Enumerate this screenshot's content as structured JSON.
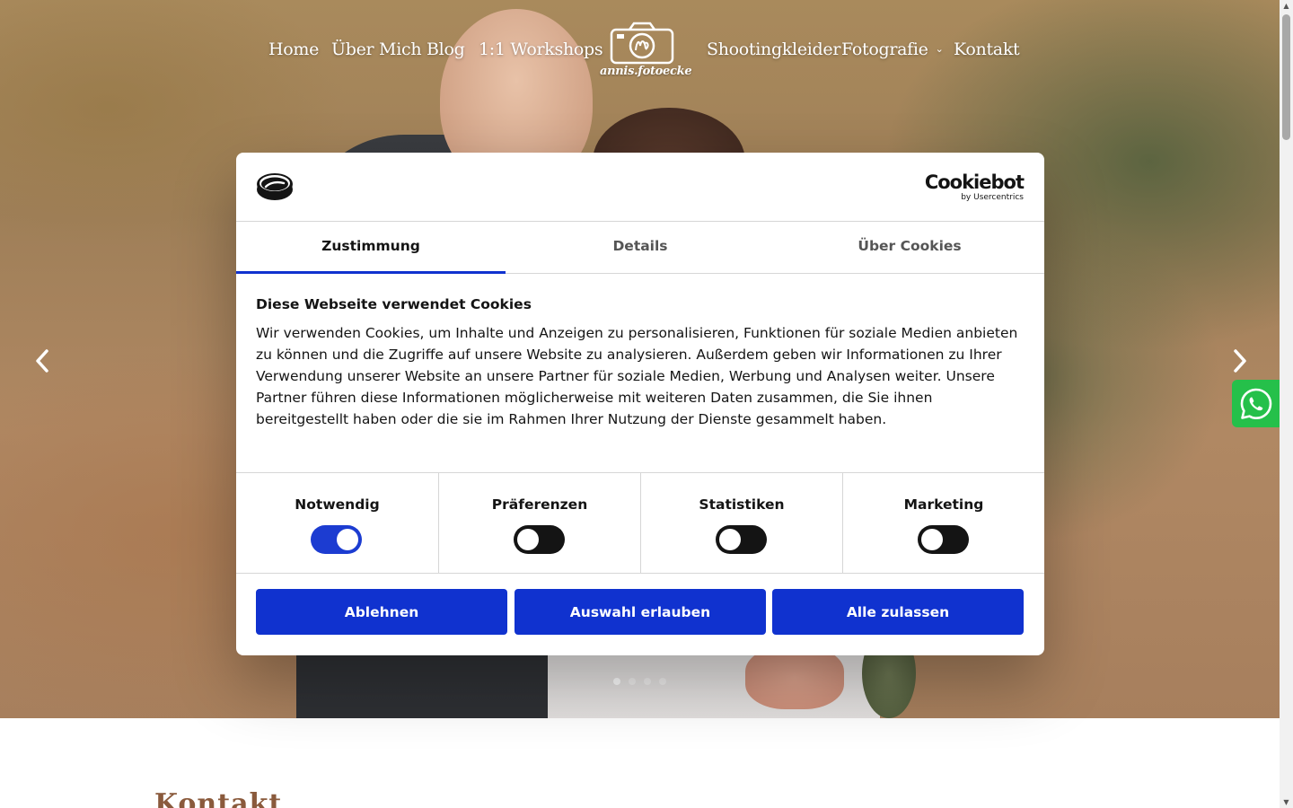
{
  "nav": {
    "items": [
      {
        "label": "Home"
      },
      {
        "label": "Über Mich"
      },
      {
        "label": "Blog"
      },
      {
        "label": "1:1 Workshops"
      },
      {
        "label": "Shootingkleider"
      },
      {
        "label": "Fotografie",
        "has_dropdown": true
      },
      {
        "label": "Kontakt"
      }
    ],
    "logo_text": "annis.fotoecke"
  },
  "slider": {
    "prev_icon": "chevron-left-icon",
    "next_icon": "chevron-right-icon",
    "slide_count": 4,
    "active_slide": 1
  },
  "whatsapp": {
    "icon": "whatsapp-icon",
    "color": "#25c04a"
  },
  "section": {
    "heading": "Kontakt"
  },
  "cookie_dialog": {
    "brand": {
      "name": "Cookiebot",
      "sub": "by Usercentrics"
    },
    "tabs": [
      {
        "label": "Zustimmung",
        "active": true
      },
      {
        "label": "Details",
        "active": false
      },
      {
        "label": "Über Cookies",
        "active": false
      }
    ],
    "title": "Diese Webseite verwendet Cookies",
    "body": "Wir verwenden Cookies, um Inhalte und Anzeigen zu personalisieren, Funktionen für soziale Medien anbieten zu können und die Zugriffe auf unsere Website zu analysieren. Außerdem geben wir Informationen zu Ihrer Verwendung unserer Website an unsere Partner für soziale Medien, Werbung und Analysen weiter. Unsere Partner führen diese Informationen möglicherweise mit weiteren Daten zusammen, die Sie ihnen bereitgestellt haben oder die sie im Rahmen Ihrer Nutzung der Dienste gesammelt haben.",
    "toggles": [
      {
        "label": "Notwendig",
        "checked": true
      },
      {
        "label": "Präferenzen",
        "checked": false
      },
      {
        "label": "Statistiken",
        "checked": false
      },
      {
        "label": "Marketing",
        "checked": false
      }
    ],
    "buttons": {
      "decline": "Ablehnen",
      "allow_selection": "Auswahl erlauben",
      "allow_all": "Alle zulassen"
    },
    "accent_color": "#1032cf"
  }
}
